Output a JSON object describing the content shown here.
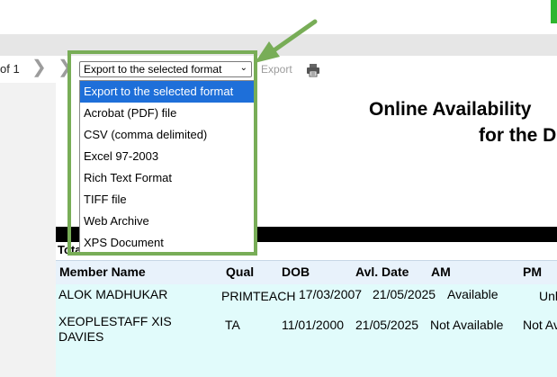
{
  "toolbar": {
    "page_of": "of 1",
    "export_select_value": "Export to the selected format",
    "export_label": "Export"
  },
  "dropdown": {
    "options": [
      "Export to the selected format",
      "Acrobat (PDF) file",
      "CSV (comma delimited)",
      "Excel 97-2003",
      "Rich Text Format",
      "TIFF file",
      "Web Archive",
      "XPS Document"
    ],
    "selected_index": 0
  },
  "report": {
    "title": "Online Availability",
    "subtitle": "for the D",
    "total_label": "Total no. of availabilities : 2"
  },
  "table": {
    "headers": [
      "Member Name",
      "Qual",
      "DOB",
      "Avl. Date",
      "AM",
      "PM"
    ],
    "rows": [
      {
        "name_line1": "ALOK MADHUKAR",
        "name_line2": "",
        "qual": "PRIMTEACH",
        "dob": "17/03/2007",
        "avl_date": "21/05/2025",
        "am": "Available",
        "pm": "Unl"
      },
      {
        "name_line1": "XEOPLESTAFF XIS",
        "name_line2": "DAVIES",
        "qual": "TA",
        "dob": "11/01/2000",
        "avl_date": "21/05/2025",
        "am": "Not Available",
        "pm": "Not Av"
      }
    ]
  },
  "colors": {
    "highlight_green": "#78ad57",
    "selection_blue": "#1e6fd9",
    "row_bg": "#e1fbfb",
    "header_bg": "#e8f2fb"
  }
}
